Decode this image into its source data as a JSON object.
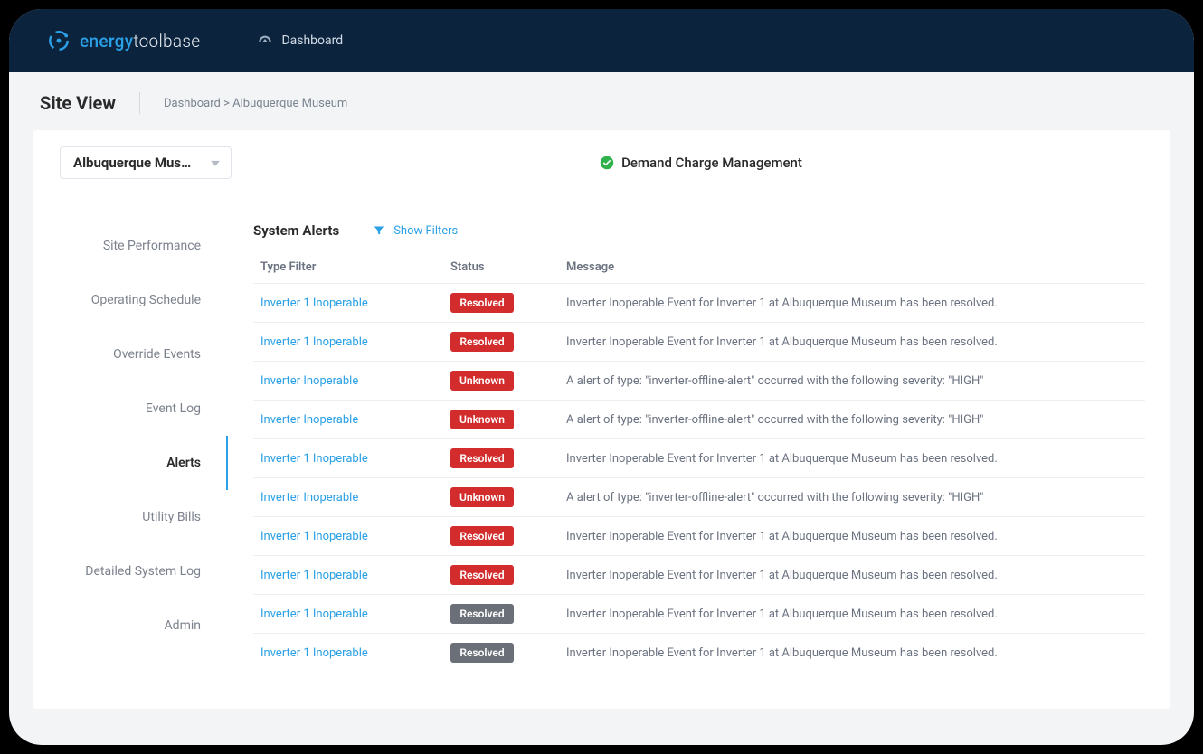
{
  "brand": {
    "part1": "energy",
    "part2": "toolbase"
  },
  "nav": {
    "dashboard": "Dashboard"
  },
  "header": {
    "title": "Site View",
    "breadcrumb_home": "Dashboard",
    "breadcrumb_sep": " > ",
    "breadcrumb_site": "Albuquerque Museum"
  },
  "site_select": {
    "value": "Albuquerque Muse…"
  },
  "mode": {
    "label": "Demand Charge Management"
  },
  "sidebar": {
    "items": [
      {
        "label": "Site Performance"
      },
      {
        "label": "Operating Schedule"
      },
      {
        "label": "Override Events"
      },
      {
        "label": "Event Log"
      },
      {
        "label": "Alerts",
        "active": true
      },
      {
        "label": "Utility Bills"
      },
      {
        "label": "Detailed System Log"
      },
      {
        "label": "Admin"
      }
    ]
  },
  "alerts": {
    "section_title": "System Alerts",
    "show_filters": "Show Filters",
    "columns": {
      "type": "Type Filter",
      "status": "Status",
      "message": "Message"
    },
    "rows": [
      {
        "type": "Inverter 1 Inoperable",
        "status": "Resolved",
        "status_color": "red",
        "message": "Inverter Inoperable Event for Inverter 1 at Albuquerque Museum has been resolved."
      },
      {
        "type": "Inverter 1 Inoperable",
        "status": "Resolved",
        "status_color": "red",
        "message": "Inverter Inoperable Event for Inverter 1 at Albuquerque Museum has been resolved."
      },
      {
        "type": "Inverter Inoperable",
        "status": "Unknown",
        "status_color": "red",
        "message": "A alert of type: \"inverter-offline-alert\" occurred with the following severity: \"HIGH\""
      },
      {
        "type": "Inverter Inoperable",
        "status": "Unknown",
        "status_color": "red",
        "message": "A alert of type: \"inverter-offline-alert\" occurred with the following severity: \"HIGH\""
      },
      {
        "type": "Inverter 1 Inoperable",
        "status": "Resolved",
        "status_color": "red",
        "message": "Inverter Inoperable Event for Inverter 1 at Albuquerque Museum has been resolved."
      },
      {
        "type": "Inverter Inoperable",
        "status": "Unknown",
        "status_color": "red",
        "message": "A alert of type: \"inverter-offline-alert\" occurred with the following severity: \"HIGH\""
      },
      {
        "type": "Inverter 1 Inoperable",
        "status": "Resolved",
        "status_color": "red",
        "message": "Inverter Inoperable Event for Inverter 1 at Albuquerque Museum has been resolved."
      },
      {
        "type": "Inverter 1 Inoperable",
        "status": "Resolved",
        "status_color": "red",
        "message": "Inverter Inoperable Event for Inverter 1 at Albuquerque Museum has been resolved."
      },
      {
        "type": "Inverter 1 Inoperable",
        "status": "Resolved",
        "status_color": "gray",
        "message": "Inverter Inoperable Event for Inverter 1 at Albuquerque Museum has been resolved."
      },
      {
        "type": "Inverter 1 Inoperable",
        "status": "Resolved",
        "status_color": "gray",
        "message": "Inverter Inoperable Event for Inverter 1 at Albuquerque Museum has been resolved."
      }
    ]
  }
}
